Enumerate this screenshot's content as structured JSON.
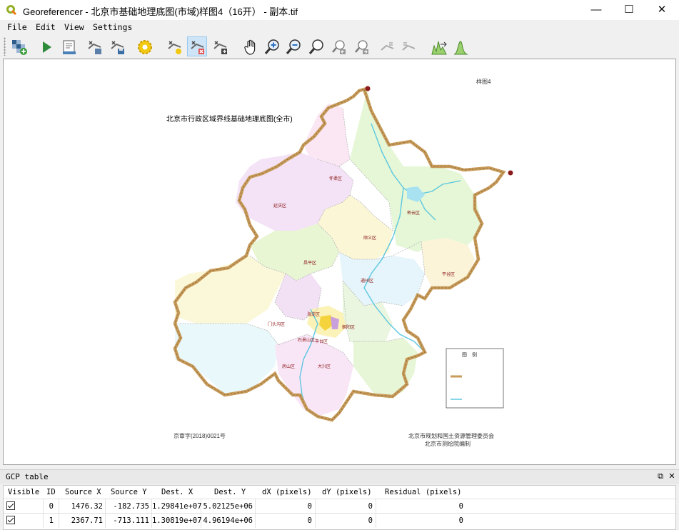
{
  "window": {
    "title": "Georeferencer - 北京市基础地理底图(市域)样图4（16开） - 副本.tif",
    "minimize": "—",
    "maximize": "☐",
    "close": "✕"
  },
  "menu": [
    "File",
    "Edit",
    "View",
    "Settings"
  ],
  "toolbar": {
    "buttons": [
      {
        "name": "open-raster-icon",
        "active": false
      },
      {
        "name": "start-georeferencing-icon",
        "active": false
      },
      {
        "name": "generate-gdal-script-icon",
        "active": false
      },
      {
        "name": "load-gcp-points-icon",
        "active": false
      },
      {
        "name": "save-gcp-points-icon",
        "active": false
      },
      {
        "name": "transformation-settings-icon",
        "active": false
      },
      {
        "name": "add-point-icon",
        "active": false
      },
      {
        "name": "delete-point-icon",
        "active": true
      },
      {
        "name": "move-gcp-point-icon",
        "active": false
      },
      {
        "name": "pan-icon",
        "active": false
      },
      {
        "name": "zoom-in-icon",
        "active": false
      },
      {
        "name": "zoom-out-icon",
        "active": false
      },
      {
        "name": "zoom-to-layer-icon",
        "active": false
      },
      {
        "name": "zoom-last-icon",
        "active": false
      },
      {
        "name": "zoom-next-icon",
        "active": false
      },
      {
        "name": "link-georeferencer-icon",
        "active": false
      },
      {
        "name": "link-qgis-icon",
        "active": false
      },
      {
        "name": "full-histogram-stretch-icon",
        "active": false
      },
      {
        "name": "local-histogram-stretch-icon",
        "active": false
      }
    ]
  },
  "map": {
    "title": "北京市行政区域界线基础地理底图(全市)",
    "corner_label": "样图4",
    "review_number": "京审字(2018)0021号",
    "publisher_line1": "北京市规划和国土资源管理委员会",
    "publisher_line2": "北京市测绘院编制",
    "legend_title": "图　例",
    "districts": [
      "怀柔区",
      "密云区",
      "延庆区",
      "昌平区",
      "顺义区",
      "平谷区",
      "门头沟区",
      "海淀区",
      "朝阳区",
      "通州区",
      "房山区",
      "大兴区",
      "丰台区",
      "石景山区"
    ],
    "colors": {
      "border": "#c89b5a",
      "river": "#5dc7e0",
      "point": "#8b1a1a"
    }
  },
  "gcp_table": {
    "title": "GCP table",
    "columns": [
      "Visible",
      "ID",
      "Source X",
      "Source Y",
      "Dest. X",
      "Dest. Y",
      "dX (pixels)",
      "dY (pixels)",
      "Residual (pixels)"
    ],
    "rows": [
      {
        "visible": true,
        "id": "0",
        "source_x": "1476.32",
        "source_y": "-182.735",
        "dest_x": "1.29841e+07",
        "dest_y": "5.02125e+06",
        "dx": "0",
        "dy": "0",
        "residual": "0"
      },
      {
        "visible": true,
        "id": "1",
        "source_x": "2367.71",
        "source_y": "-713.111",
        "dest_x": "1.30819e+07",
        "dest_y": "4.96194e+06",
        "dx": "0",
        "dy": "0",
        "residual": "0"
      }
    ]
  }
}
